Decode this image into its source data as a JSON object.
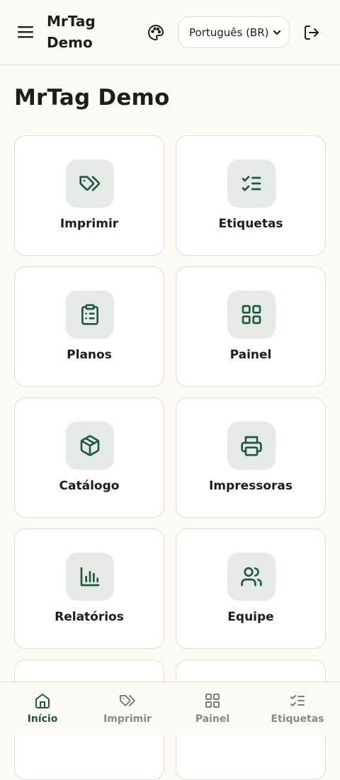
{
  "header": {
    "app_title": "MrTag Demo",
    "language_selected": "Português (BR)"
  },
  "page_title": "MrTag Demo",
  "cards": [
    {
      "label": "Imprimir",
      "icon": "tags-icon"
    },
    {
      "label": "Etiquetas",
      "icon": "list-checks-icon"
    },
    {
      "label": "Planos",
      "icon": "clipboard-list-icon"
    },
    {
      "label": "Painel",
      "icon": "grid-icon"
    },
    {
      "label": "Catálogo",
      "icon": "package-icon"
    },
    {
      "label": "Impressoras",
      "icon": "printer-icon"
    },
    {
      "label": "Relatórios",
      "icon": "bar-chart-icon"
    },
    {
      "label": "Equipe",
      "icon": "users-icon"
    }
  ],
  "bottom_nav": [
    {
      "label": "Início",
      "icon": "home-icon",
      "active": true
    },
    {
      "label": "Imprimir",
      "icon": "tags-icon",
      "active": false
    },
    {
      "label": "Painel",
      "icon": "grid-icon",
      "active": false
    },
    {
      "label": "Etiquetas",
      "icon": "list-checks-icon",
      "active": false
    }
  ],
  "colors": {
    "background": "#fcfbf5",
    "accent": "#1f5a3e",
    "icon_box": "#e6eae6",
    "inactive_nav": "#8a8a86"
  }
}
